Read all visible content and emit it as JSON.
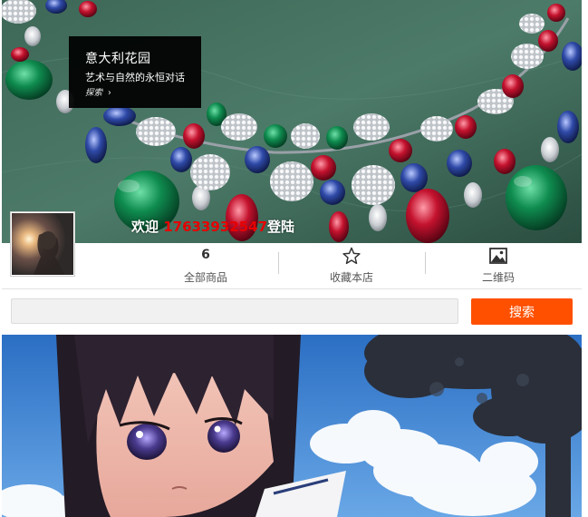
{
  "banner": {
    "promo_title": "意大利花园",
    "promo_subtitle": "艺术与自然的永恒对话",
    "promo_link": "探索",
    "promo_link_icon": "chevron-right-icon"
  },
  "welcome": {
    "prefix": "欢迎 ",
    "phone": "17633932547",
    "suffix": "登陆"
  },
  "stats": [
    {
      "value": "6",
      "label": "全部商品"
    },
    {
      "icon": "star-outline-icon",
      "label": "收藏本店"
    },
    {
      "icon": "picture-icon",
      "label": "二维码"
    }
  ],
  "search": {
    "value": "",
    "placeholder": "",
    "button_label": "搜索"
  },
  "colors": {
    "accent": "#ff5000",
    "welcome_phone": "#e60000",
    "banner_bg": "#3f6a59"
  }
}
